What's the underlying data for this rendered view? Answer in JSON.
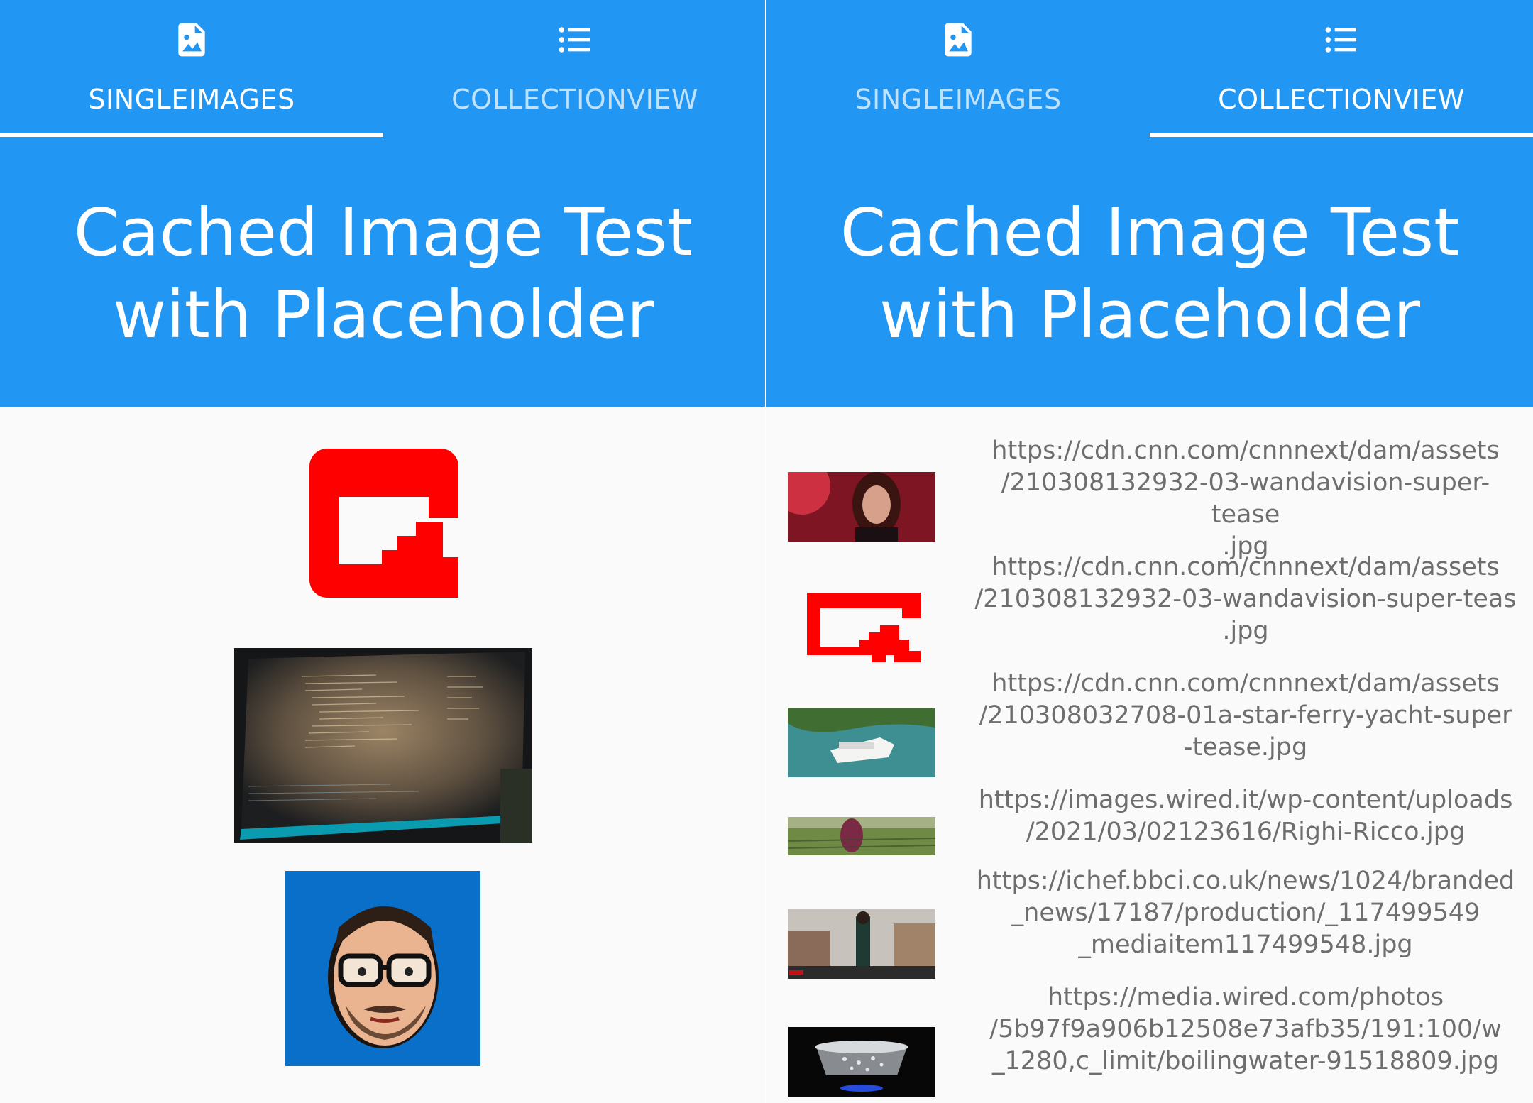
{
  "left_screen": {
    "tabs": [
      {
        "label": "SINGLEIMAGES",
        "icon": "image-file-icon",
        "active": true
      },
      {
        "label": "COLLECTIONVIEW",
        "icon": "list-icon",
        "active": false
      }
    ],
    "title": "Cached Image Test\nwith Placeholder"
  },
  "right_screen": {
    "tabs": [
      {
        "label": "SINGLEIMAGES",
        "icon": "image-file-icon",
        "active": false
      },
      {
        "label": "COLLECTIONVIEW",
        "icon": "list-icon",
        "active": true
      }
    ],
    "title": "Cached Image Test\nwith Placeholder",
    "items": [
      {
        "url": "https://cdn.cnn.com/cnnnext/dam/assets\n/210308132932-03-wandavision-super-tease\n.jpg"
      },
      {
        "url": "https://cdn.cnn.com/cnnnext/dam/assets\n/210308132932-03-wandavision-super-teas\n.jpg"
      },
      {
        "url": "https://cdn.cnn.com/cnnnext/dam/assets\n/210308032708-01a-star-ferry-yacht-super\n-tease.jpg"
      },
      {
        "url": "https://images.wired.it/wp-content/uploads\n/2021/03/02123616/Righi-Ricco.jpg"
      },
      {
        "url": "https://ichef.bbci.co.uk/news/1024/branded\n_news/17187/production/_117499549\n_mediaitem117499548.jpg"
      },
      {
        "url": "https://media.wired.com/photos\n/5b97f9a906b12508e73afb35/191:100/w\n_1280,c_limit/boilingwater-91518809.jpg"
      }
    ]
  },
  "colors": {
    "primary": "#2196f3",
    "placeholder_red": "#ff0000",
    "background": "#fafafa",
    "url_text": "#6e6e6e"
  }
}
